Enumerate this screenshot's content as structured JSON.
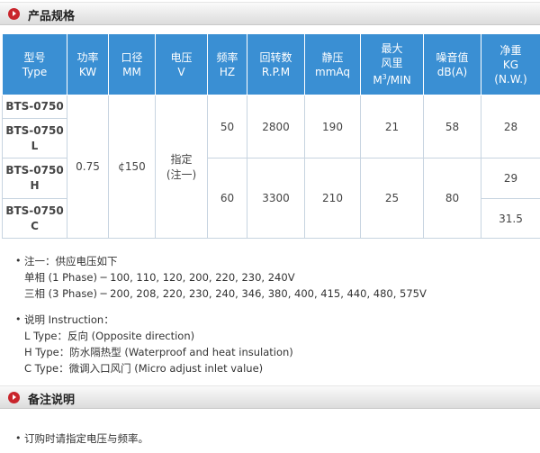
{
  "spec_section": {
    "title": "产品规格"
  },
  "table": {
    "headers": [
      {
        "line1": "型号",
        "line2": "Type"
      },
      {
        "line1": "功率",
        "line2": "KW"
      },
      {
        "line1": "口径",
        "line2": "MM"
      },
      {
        "line1": "电压",
        "line2": "V"
      },
      {
        "line1": "频率",
        "line2": "HZ"
      },
      {
        "line1": "回转数",
        "line2": "R.P.M"
      },
      {
        "line1": "静压",
        "line2": "mmAq"
      },
      {
        "line1": "最大",
        "line2": "风里",
        "line3a": "M",
        "sup": "3",
        "line3b": "/MIN"
      },
      {
        "line1": "噪音值",
        "line2": "dB(A)"
      },
      {
        "line1": "净重",
        "line2": "KG",
        "line3": "(N.W.)"
      }
    ],
    "models": [
      {
        "a": "BTS-0750",
        "b": ""
      },
      {
        "a": "BTS-0750",
        "b": "L"
      },
      {
        "a": "BTS-0750",
        "b": "H"
      },
      {
        "a": "BTS-0750",
        "b": "C"
      }
    ],
    "power": "0.75",
    "diameter": "¢150",
    "voltage_l1": "指定",
    "voltage_l2": "(注一)",
    "row_a": {
      "hz": "50",
      "rpm": "2800",
      "pressure": "190",
      "flow": "21",
      "noise": "58",
      "weight": "28"
    },
    "row_b": {
      "hz": "60",
      "rpm": "3300",
      "pressure": "210",
      "flow": "25",
      "noise": "80",
      "weight_h": "29",
      "weight_c": "31.5"
    }
  },
  "note1": {
    "title": "注一：供应电压如下",
    "single": "单相 (1 Phase) ─ 100, 110, 120, 200, 220, 230, 240V",
    "three": "三相 (3 Phase) ─ 200, 208, 220, 230, 240, 346, 380, 400, 415, 440, 480, 575V"
  },
  "instruction": {
    "title": "说明 Instruction：",
    "l": "L Type：反向 (Opposite direction)",
    "h": "H Type：防水隔热型 (Waterproof and heat insulation)",
    "c": "C Type：微调入口风门 (Micro adjust inlet value)"
  },
  "remarks_section": {
    "title": "备注说明"
  },
  "remark": "订购时请指定电压与频率。"
}
